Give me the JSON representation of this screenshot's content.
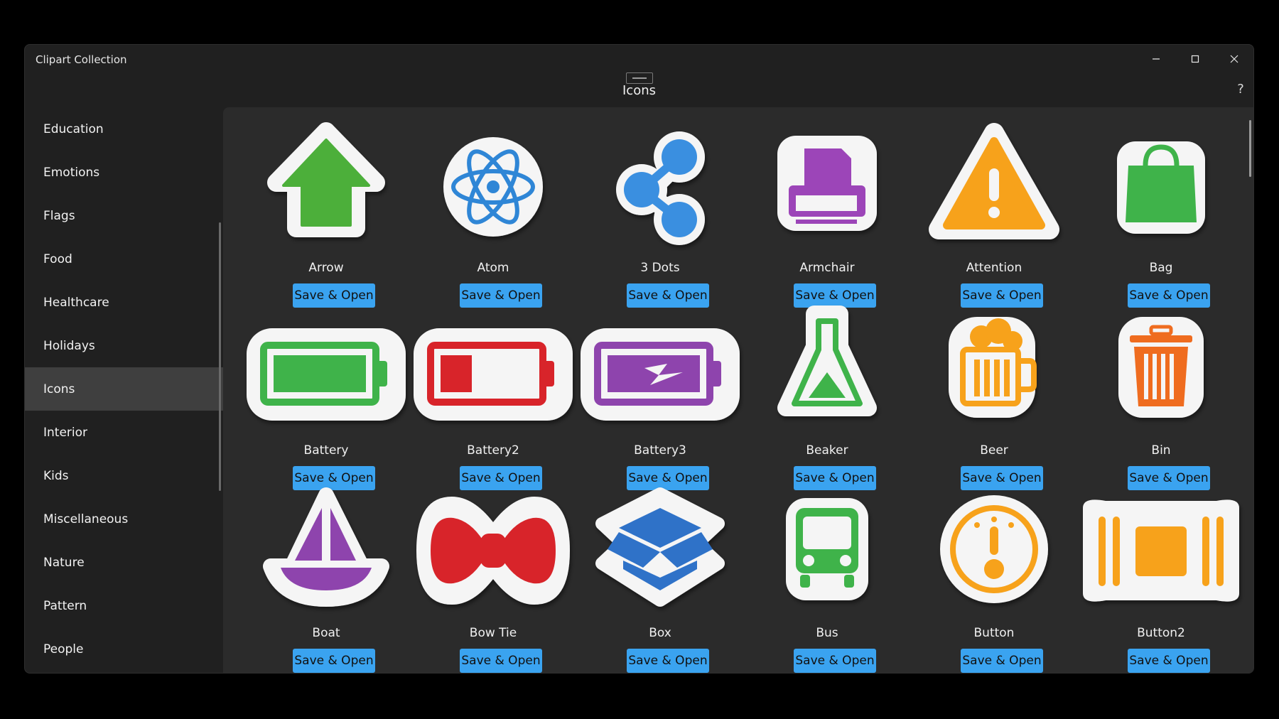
{
  "window": {
    "app_title": "Clipart Collection",
    "page_title": "Icons",
    "help_label": "?",
    "controls": {
      "minimize": "minimize-icon",
      "maximize": "maximize-icon",
      "close": "close-icon"
    }
  },
  "sidebar": {
    "items": [
      {
        "label": "Education",
        "active": false
      },
      {
        "label": "Emotions",
        "active": false
      },
      {
        "label": "Flags",
        "active": false
      },
      {
        "label": "Food",
        "active": false
      },
      {
        "label": "Healthcare",
        "active": false
      },
      {
        "label": "Holidays",
        "active": false
      },
      {
        "label": "Icons",
        "active": true
      },
      {
        "label": "Interior",
        "active": false
      },
      {
        "label": "Kids",
        "active": false
      },
      {
        "label": "Miscellaneous",
        "active": false
      },
      {
        "label": "Nature",
        "active": false
      },
      {
        "label": "Pattern",
        "active": false
      },
      {
        "label": "People",
        "active": false
      }
    ]
  },
  "tiles": {
    "button_label": "Save & Open",
    "items": [
      {
        "label": "Arrow",
        "icon": "arrow-icon",
        "color": "#4caf3a"
      },
      {
        "label": "Atom",
        "icon": "atom-icon",
        "color": "#2f86d6"
      },
      {
        "label": "3 Dots",
        "icon": "share-icon",
        "color": "#3a8fe0"
      },
      {
        "label": "Armchair",
        "icon": "armchair-icon",
        "color": "#9c45b8"
      },
      {
        "label": "Attention",
        "icon": "warning-icon",
        "color": "#f7a21b"
      },
      {
        "label": "Bag",
        "icon": "bag-icon",
        "color": "#3fb34a"
      },
      {
        "label": "Battery",
        "icon": "battery-icon",
        "color": "#3fb34a"
      },
      {
        "label": "Battery2",
        "icon": "battery-low-icon",
        "color": "#d8242a"
      },
      {
        "label": "Battery3",
        "icon": "battery-charging-icon",
        "color": "#8e44ad"
      },
      {
        "label": "Beaker",
        "icon": "beaker-icon",
        "color": "#3fb34a"
      },
      {
        "label": "Beer",
        "icon": "beer-icon",
        "color": "#f7a21b"
      },
      {
        "label": "Bin",
        "icon": "bin-icon",
        "color": "#ef6c1f"
      },
      {
        "label": "Boat",
        "icon": "boat-icon",
        "color": "#8e44ad"
      },
      {
        "label": "Bow Tie",
        "icon": "bow-tie-icon",
        "color": "#d8242a"
      },
      {
        "label": "Box",
        "icon": "box-icon",
        "color": "#2f72c8"
      },
      {
        "label": "Bus",
        "icon": "bus-icon",
        "color": "#3fb34a"
      },
      {
        "label": "Button",
        "icon": "dial-icon",
        "color": "#f7a21b"
      },
      {
        "label": "Button2",
        "icon": "button-bar-icon",
        "color": "#f7a21b"
      }
    ]
  }
}
